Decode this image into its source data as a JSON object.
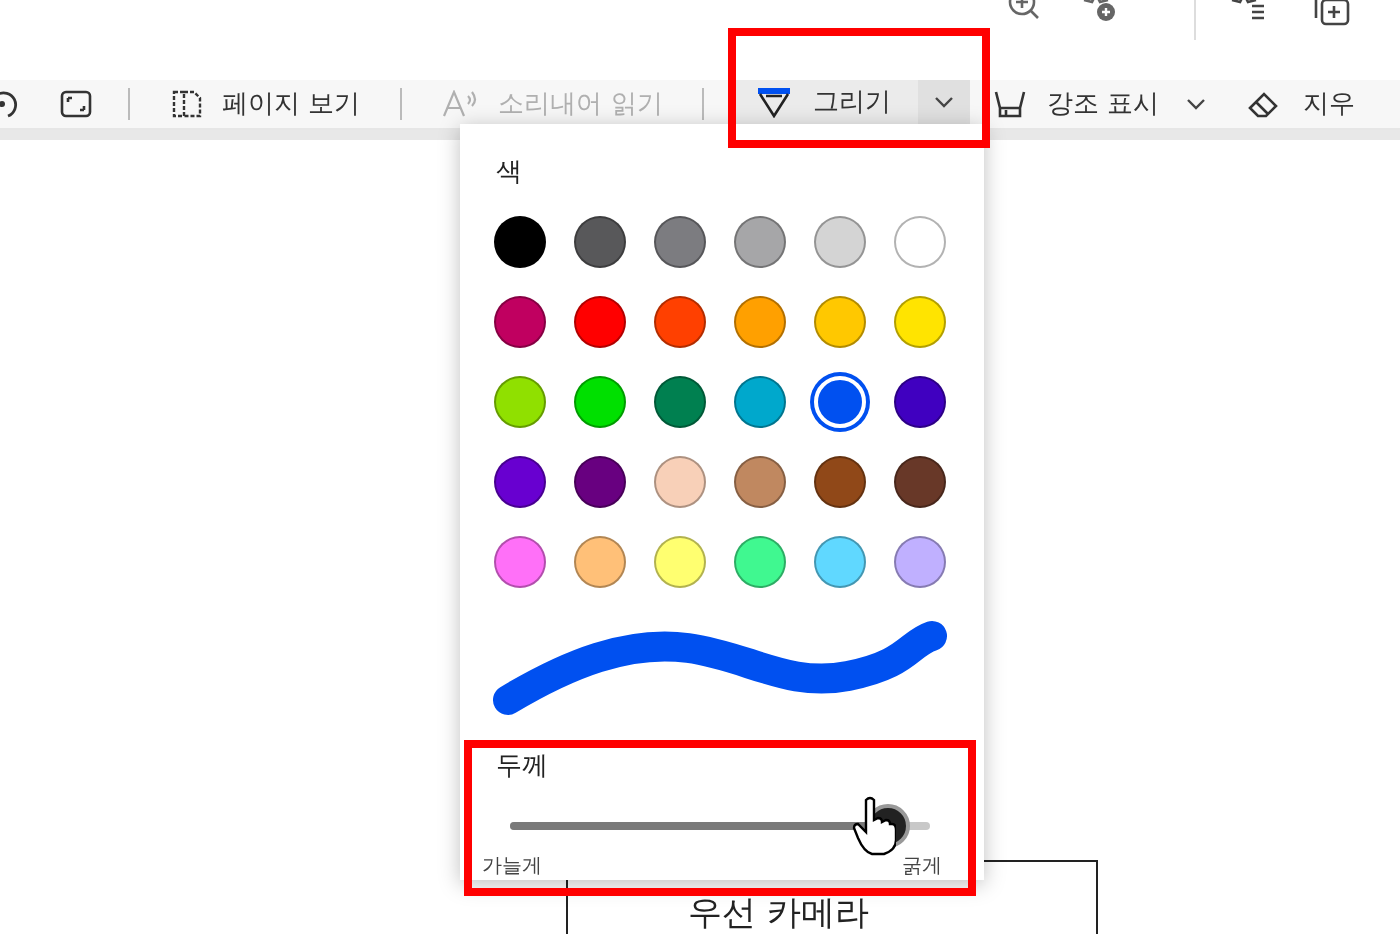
{
  "toolbar": {
    "items": [
      {
        "label": "페이지 보기",
        "disabled": false,
        "selected": false,
        "dropdown": false
      },
      {
        "label": "소리내어 읽기",
        "disabled": true,
        "selected": false,
        "dropdown": false
      },
      {
        "label": "그리기",
        "disabled": false,
        "selected": true,
        "dropdown": true
      },
      {
        "label": "강조 표시",
        "disabled": false,
        "selected": false,
        "dropdown": true
      },
      {
        "label": "지우",
        "disabled": false,
        "selected": false,
        "dropdown": false
      }
    ]
  },
  "draw_panel": {
    "color_heading": "색",
    "colors": [
      {
        "color": "#000000",
        "selected": false
      },
      {
        "color": "#58585a",
        "selected": false
      },
      {
        "color": "#7c7c80",
        "selected": false
      },
      {
        "color": "#a6a6a8",
        "selected": false
      },
      {
        "color": "#d4d4d4",
        "selected": false
      },
      {
        "color": "#ffffff",
        "selected": false
      },
      {
        "color": "#c00060",
        "selected": false
      },
      {
        "color": "#ff0000",
        "selected": false
      },
      {
        "color": "#ff4000",
        "selected": false
      },
      {
        "color": "#ffa000",
        "selected": false
      },
      {
        "color": "#ffc800",
        "selected": false
      },
      {
        "color": "#ffe400",
        "selected": false
      },
      {
        "color": "#90e000",
        "selected": false
      },
      {
        "color": "#00e000",
        "selected": false
      },
      {
        "color": "#008050",
        "selected": false
      },
      {
        "color": "#00a8cc",
        "selected": false
      },
      {
        "color": "#0050f0",
        "selected": true
      },
      {
        "color": "#4000c0",
        "selected": false
      },
      {
        "color": "#6800d0",
        "selected": false
      },
      {
        "color": "#680080",
        "selected": false
      },
      {
        "color": "#f8d0b8",
        "selected": false
      },
      {
        "color": "#c08860",
        "selected": false
      },
      {
        "color": "#904818",
        "selected": false
      },
      {
        "color": "#683828",
        "selected": false
      },
      {
        "color": "#ff70f8",
        "selected": false
      },
      {
        "color": "#ffc078",
        "selected": false
      },
      {
        "color": "#ffff70",
        "selected": false
      },
      {
        "color": "#40f890",
        "selected": false
      },
      {
        "color": "#60d8ff",
        "selected": false
      },
      {
        "color": "#c0b0ff",
        "selected": false
      }
    ],
    "thickness": {
      "label": "두께",
      "level": 0.9,
      "min_label": "가늘게",
      "max_label": "굵게"
    }
  },
  "document": {
    "text": "우선 카메라"
  }
}
